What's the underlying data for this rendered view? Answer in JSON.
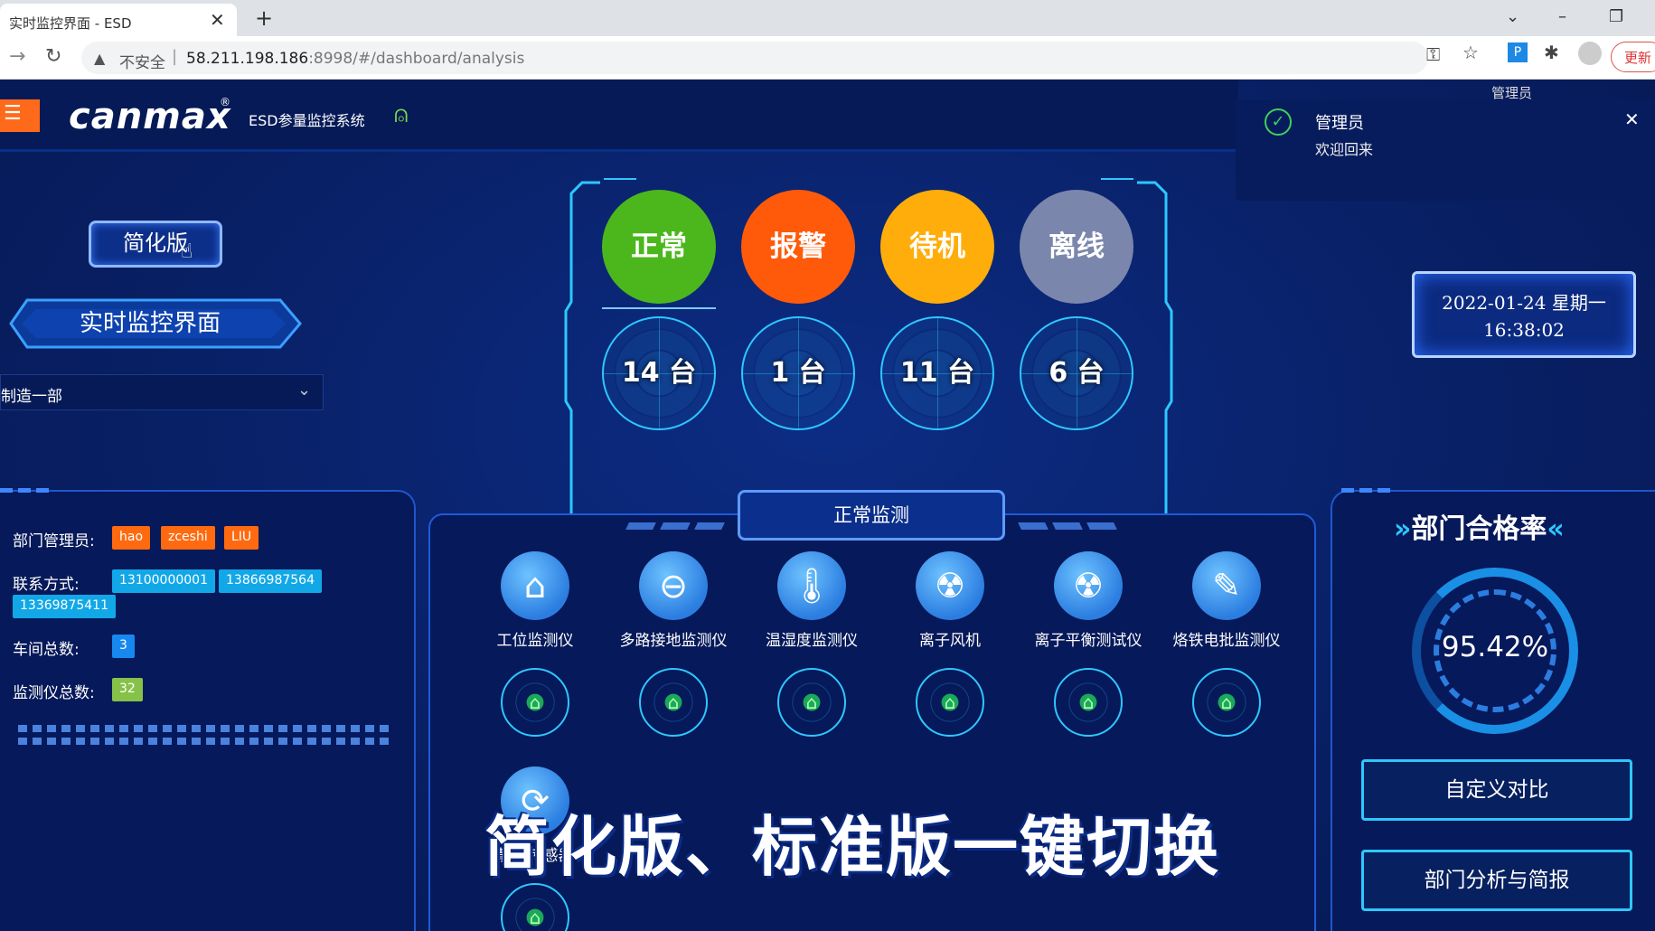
{
  "browser": {
    "tab_title": "实时监控界面 - ESD",
    "tab_close": "✕",
    "new_tab": "+",
    "insecure_label": "不安全",
    "url_host": "58.211.198.186",
    "url_rest": ":8998/#/dashboard/analysis",
    "update_label": "更新"
  },
  "header": {
    "logo": "canmax",
    "logo_reg": "®",
    "system_title": "ESD参量监控系统",
    "user_name": "管理员"
  },
  "notification": {
    "title": "管理员",
    "message": "欢迎回来"
  },
  "left": {
    "simplify_button": "简化版",
    "page_title": "实时监控界面",
    "department": "制造一部",
    "info": {
      "admin_label": "部门管理员:",
      "admins": [
        "hao",
        "zceshi",
        "LIU"
      ],
      "contact_label": "联系方式:",
      "contacts": [
        "13100000001",
        "13866987564",
        "13369875411"
      ],
      "workshop_label": "车间总数:",
      "workshop_count": "3",
      "monitor_label": "监测仪总数:",
      "monitor_count": "32"
    }
  },
  "status": {
    "items": [
      {
        "label": "正常",
        "count": "14 台",
        "color": "#4cb71c"
      },
      {
        "label": "报警",
        "count": "1 台",
        "color": "#ff5a0a"
      },
      {
        "label": "待机",
        "count": "11 台",
        "color": "#ffad0a"
      },
      {
        "label": "离线",
        "count": "6 台",
        "color": "#7b86ad"
      }
    ]
  },
  "datetime": {
    "date": "2022-01-24 星期一",
    "time": "16:38:02"
  },
  "center": {
    "tab_label": "正常监测",
    "devices": [
      {
        "name": "工位监测仪",
        "icon": "workstation-icon"
      },
      {
        "name": "多路接地监测仪",
        "icon": "grounding-icon"
      },
      {
        "name": "温湿度监测仪",
        "icon": "thermometer-icon"
      },
      {
        "name": "离子风机",
        "icon": "ion-fan-icon"
      },
      {
        "name": "离子平衡测试仪",
        "icon": "ion-balance-icon"
      },
      {
        "name": "烙铁电批监测仪",
        "icon": "soldering-iron-icon"
      },
      {
        "name": "静电传感器",
        "icon": "sensor-icon"
      }
    ],
    "caption": "简化版、标准版一键切换"
  },
  "right": {
    "rate_title": "部门合格率",
    "rate_value": "95.42%",
    "compare_button": "自定义对比",
    "report_button": "部门分析与简报"
  }
}
